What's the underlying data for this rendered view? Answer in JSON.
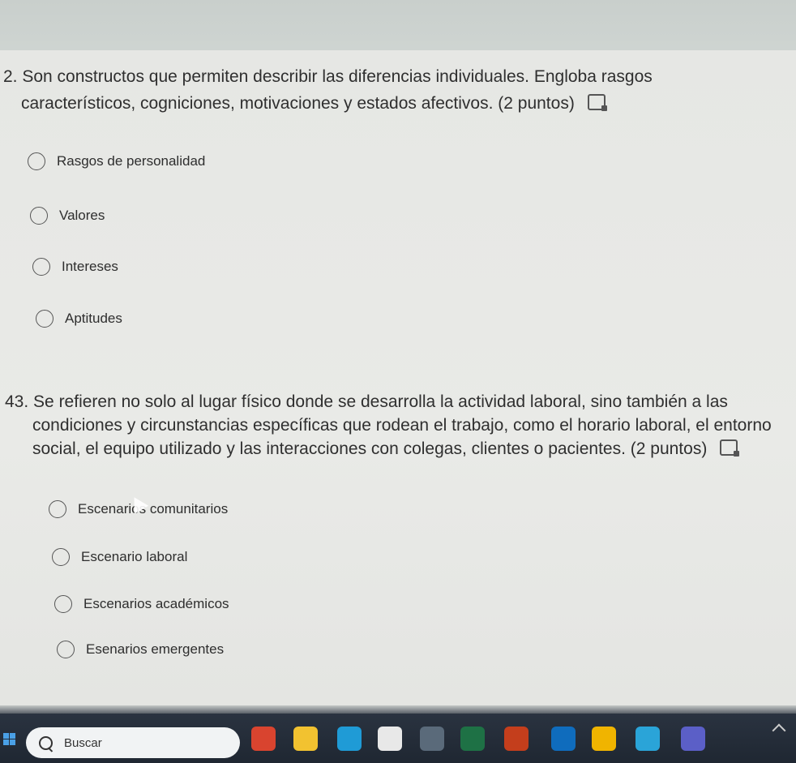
{
  "questions": [
    {
      "number": "2.",
      "text_line1": "Son constructos que permiten describir las diferencias individuales. Engloba rasgos",
      "text_line2": "característicos, cogniciones, motivaciones y estados afectivos. (2 puntos)",
      "options": [
        "Rasgos de personalidad",
        "Valores",
        "Intereses",
        "Aptitudes"
      ]
    },
    {
      "number": "43.",
      "text_line1": "Se refieren no solo al lugar físico donde se desarrolla la actividad laboral, sino también a las",
      "text_line2": "condiciones y circunstancias específicas que rodean el trabajo, como el horario laboral, el entorno",
      "text_line3": "social, el equipo utilizado y las interacciones con colegas, clientes o pacientes. (2 puntos)",
      "options": [
        "Escenarios comunitarios",
        "Escenario laboral",
        "Escenarios académicos",
        "Esenarios emergentes"
      ]
    }
  ],
  "taskbar": {
    "search_placeholder": "Buscar",
    "apps": [
      {
        "icon": "m365-app-icon",
        "color": "#d9442f"
      },
      {
        "icon": "file-explorer-icon",
        "color": "#f2c230"
      },
      {
        "icon": "edge-browser-icon",
        "color": "#1f9bd6"
      },
      {
        "icon": "snipping-tool-icon",
        "color": "#e8e8e8"
      },
      {
        "icon": "calculator-icon",
        "color": "#5a6a7a"
      },
      {
        "icon": "excel-icon",
        "color": "#1e7145"
      },
      {
        "icon": "powerpoint-icon",
        "color": "#c43e1c"
      },
      {
        "icon": "outlook-icon",
        "color": "#0f6cbd"
      },
      {
        "icon": "chrome-icon",
        "color": "#f0b400"
      },
      {
        "icon": "cortana-icon",
        "color": "#2aa4d8"
      },
      {
        "icon": "teams-icon",
        "color": "#5b5fc7"
      }
    ]
  }
}
